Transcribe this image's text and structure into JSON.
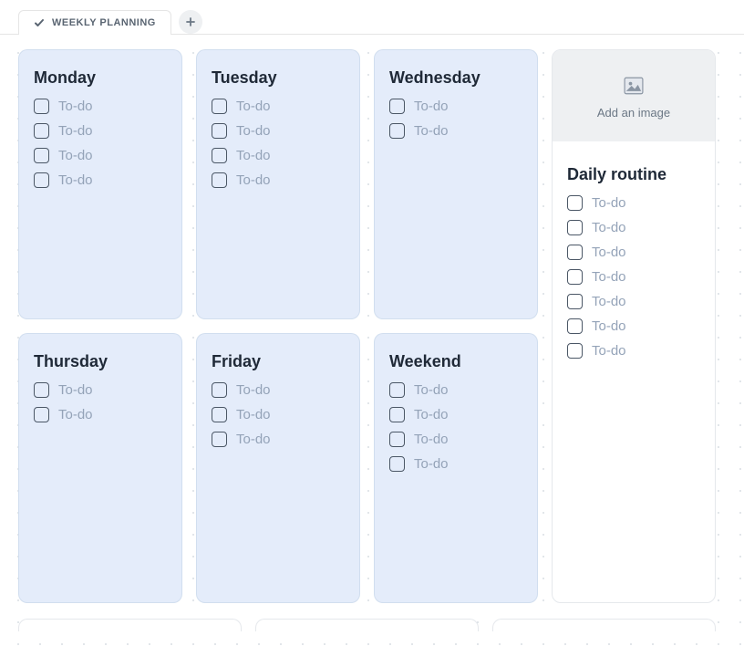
{
  "tab": {
    "label": "WEEKLY PLANNING"
  },
  "addImage": {
    "label": "Add an image"
  },
  "cards": {
    "monday": {
      "title": "Monday",
      "todos": [
        "To-do",
        "To-do",
        "To-do",
        "To-do"
      ]
    },
    "tuesday": {
      "title": "Tuesday",
      "todos": [
        "To-do",
        "To-do",
        "To-do",
        "To-do"
      ]
    },
    "wednesday": {
      "title": "Wednesday",
      "todos": [
        "To-do",
        "To-do"
      ]
    },
    "daily": {
      "title": "Daily routine",
      "todos": [
        "To-do",
        "To-do",
        "To-do",
        "To-do",
        "To-do",
        "To-do",
        "To-do"
      ]
    },
    "thursday": {
      "title": "Thursday",
      "todos": [
        "To-do",
        "To-do"
      ]
    },
    "friday": {
      "title": "Friday",
      "todos": [
        "To-do",
        "To-do",
        "To-do"
      ]
    },
    "weekend": {
      "title": "Weekend",
      "todos": [
        "To-do",
        "To-do",
        "To-do",
        "To-do"
      ]
    }
  }
}
